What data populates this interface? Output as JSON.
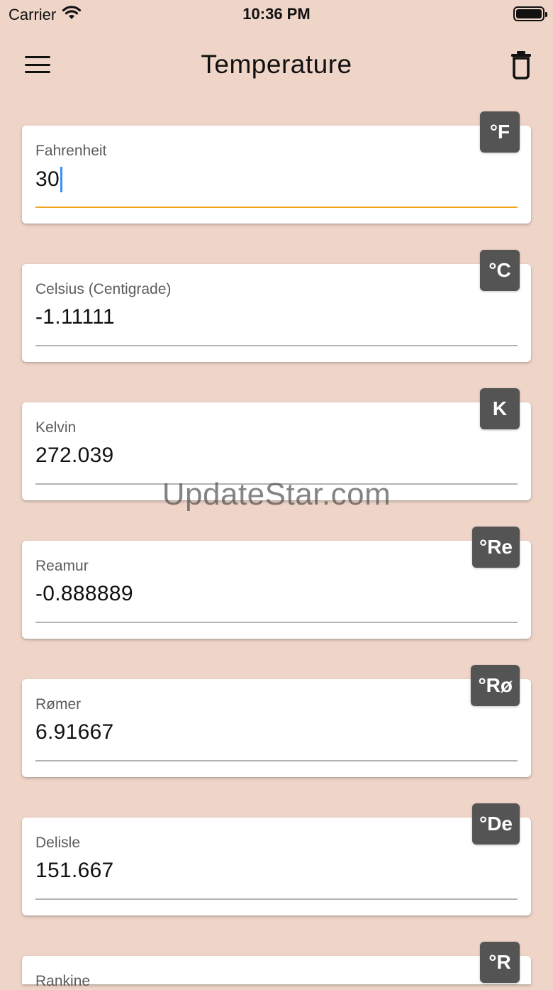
{
  "status_bar": {
    "carrier": "Carrier",
    "time": "10:36 PM"
  },
  "app_bar": {
    "title": "Temperature",
    "menu_icon": "hamburger-menu-icon",
    "clear_icon": "trash-icon"
  },
  "accent_color": "#f0a623",
  "caret_color": "#3d8ef0",
  "badge_color": "#545454",
  "background_color": "#efd5c8",
  "cards": [
    {
      "label": "Fahrenheit",
      "value": "30",
      "unit": "°F",
      "active": true
    },
    {
      "label": "Celsius (Centigrade)",
      "value": "-1.11111",
      "unit": "°C",
      "active": false
    },
    {
      "label": "Kelvin",
      "value": "272.039",
      "unit": "K",
      "active": false
    },
    {
      "label": "Reamur",
      "value": "-0.888889",
      "unit": "°Re",
      "active": false
    },
    {
      "label": "Rømer",
      "value": "6.91667",
      "unit": "°Rø",
      "active": false
    },
    {
      "label": "Delisle",
      "value": "151.667",
      "unit": "°De",
      "active": false
    },
    {
      "label": "Rankine",
      "value": "",
      "unit": "°R",
      "active": false
    }
  ],
  "watermark": "UpdateStar.com"
}
